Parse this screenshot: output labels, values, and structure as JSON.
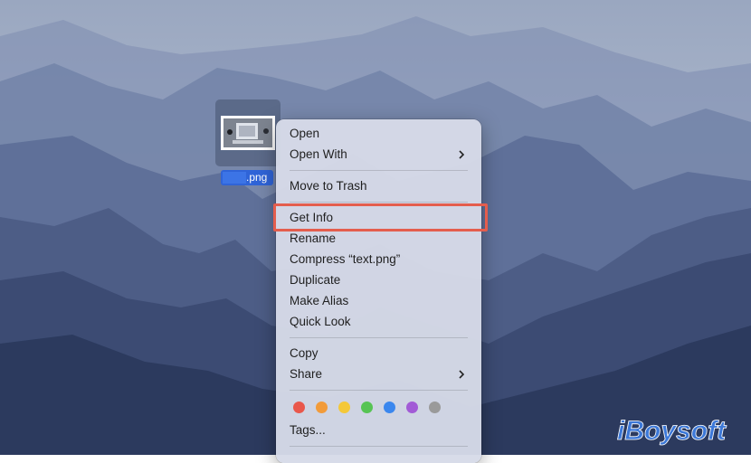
{
  "desktop": {
    "file_name_suffix": ".png"
  },
  "context_menu": {
    "items": [
      {
        "label": "Open"
      },
      {
        "label": "Open With",
        "submenu": true
      },
      {
        "label": "Move to Trash"
      },
      {
        "label": "Get Info",
        "highlighted": true
      },
      {
        "label": "Rename"
      },
      {
        "label": "Compress “text.png”"
      },
      {
        "label": "Duplicate"
      },
      {
        "label": "Make Alias"
      },
      {
        "label": "Quick Look"
      },
      {
        "label": "Copy"
      },
      {
        "label": "Share",
        "submenu": true
      },
      {
        "label": "Tags..."
      }
    ],
    "tag_colors": [
      "#e9574b",
      "#f29b3a",
      "#f4c839",
      "#57c454",
      "#3b87ee",
      "#a25bd6",
      "#9a9a9a"
    ],
    "highlight_color": "#e45d4d"
  },
  "watermark": {
    "text": "iBoysoft",
    "color": "#3c78d8"
  }
}
